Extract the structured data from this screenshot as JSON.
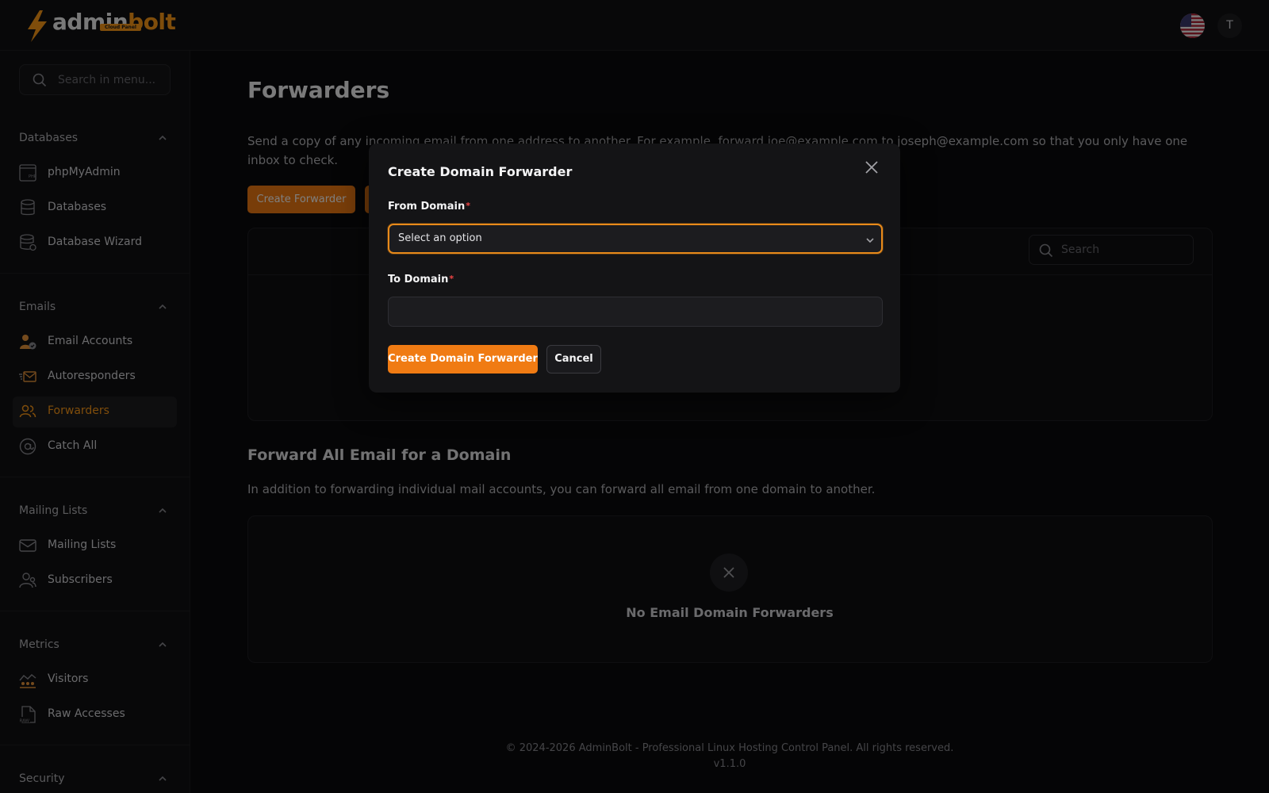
{
  "header": {
    "logo_primary": "admin",
    "logo_accent": "bolt",
    "logo_badge": "Cloud Panel",
    "avatar_initial": "T"
  },
  "sidebar": {
    "search_placeholder": "Search in menu...",
    "groups": [
      {
        "title": "Databases",
        "items": [
          "phpMyAdmin",
          "Databases",
          "Database Wizard"
        ]
      },
      {
        "title": "Emails",
        "items": [
          "Email Accounts",
          "Autoresponders",
          "Forwarders",
          "Catch All"
        ]
      },
      {
        "title": "Mailing Lists",
        "items": [
          "Mailing Lists",
          "Subscribers"
        ]
      },
      {
        "title": "Metrics",
        "items": [
          "Visitors",
          "Raw Accesses"
        ]
      },
      {
        "title": "Security",
        "items": []
      }
    ],
    "active_item": "Forwarders"
  },
  "main": {
    "title": "Forwarders",
    "description": "Send a copy of any incoming email from one address to another. For example, forward joe@example.com to joseph@example.com so that you only have one inbox to check.",
    "create_forwarder_label": "Create Forwarder",
    "table_search_placeholder": "Search",
    "domain_section_title": "Forward All Email for a Domain",
    "domain_section_desc": "In addition to forwarding individual mail accounts, you can forward all email from one domain to another.",
    "empty_state": "No Email Domain Forwarders"
  },
  "modal": {
    "title": "Create Domain Forwarder",
    "from_label": "From Domain",
    "from_value": "Select an option",
    "to_label": "To Domain",
    "to_value": "",
    "submit_label": "Create Domain Forwarder",
    "cancel_label": "Cancel"
  },
  "footer": {
    "copyright": "© 2024-2026 AdminBolt - Professional Linux Hosting Control Panel. All rights reserved.",
    "version": "v1.1.0"
  },
  "colors": {
    "accent": "#f07b13",
    "background": "#0b0b0c",
    "sidebar": "#111113"
  }
}
